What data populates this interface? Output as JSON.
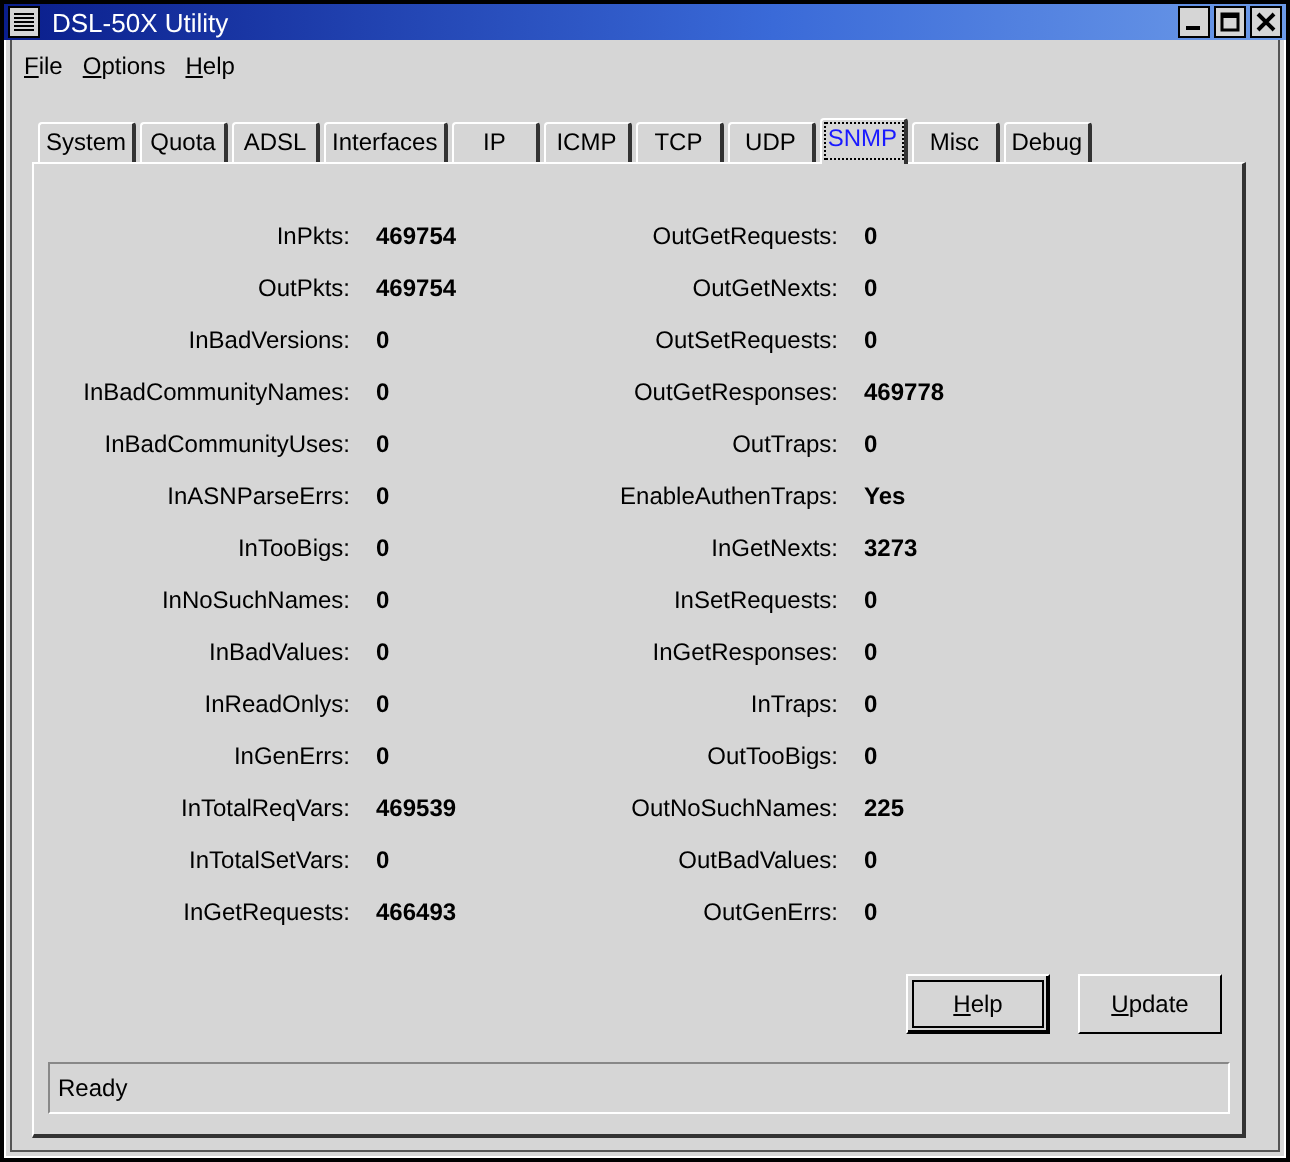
{
  "window": {
    "title": "DSL-50X Utility"
  },
  "menu": [
    {
      "label": "File",
      "mnemonic": true
    },
    {
      "label": "Options",
      "mnemonic": true
    },
    {
      "label": "Help",
      "mnemonic": true
    }
  ],
  "tabs": [
    {
      "label": "System",
      "selected": false
    },
    {
      "label": "Quota",
      "selected": false
    },
    {
      "label": "ADSL",
      "selected": false
    },
    {
      "label": "Interfaces",
      "selected": false
    },
    {
      "label": "IP",
      "selected": false
    },
    {
      "label": "ICMP",
      "selected": false
    },
    {
      "label": "TCP",
      "selected": false
    },
    {
      "label": "UDP",
      "selected": false
    },
    {
      "label": "SNMP",
      "selected": true
    },
    {
      "label": "Misc",
      "selected": false
    },
    {
      "label": "Debug",
      "selected": false
    }
  ],
  "stats_left": [
    {
      "label": "InPkts:",
      "value": "469754"
    },
    {
      "label": "OutPkts:",
      "value": "469754"
    },
    {
      "label": "InBadVersions:",
      "value": "0"
    },
    {
      "label": "InBadCommunityNames:",
      "value": "0"
    },
    {
      "label": "InBadCommunityUses:",
      "value": "0"
    },
    {
      "label": "InASNParseErrs:",
      "value": "0"
    },
    {
      "label": "InTooBigs:",
      "value": "0"
    },
    {
      "label": "InNoSuchNames:",
      "value": "0"
    },
    {
      "label": "InBadValues:",
      "value": "0"
    },
    {
      "label": "InReadOnlys:",
      "value": "0"
    },
    {
      "label": "InGenErrs:",
      "value": "0"
    },
    {
      "label": "InTotalReqVars:",
      "value": "469539"
    },
    {
      "label": "InTotalSetVars:",
      "value": "0"
    },
    {
      "label": "InGetRequests:",
      "value": "466493"
    }
  ],
  "stats_right": [
    {
      "label": "OutGetRequests:",
      "value": "0"
    },
    {
      "label": "OutGetNexts:",
      "value": "0"
    },
    {
      "label": "OutSetRequests:",
      "value": "0"
    },
    {
      "label": "OutGetResponses:",
      "value": "469778"
    },
    {
      "label": "OutTraps:",
      "value": "0"
    },
    {
      "label": "EnableAuthenTraps:",
      "value": "Yes"
    },
    {
      "label": "InGetNexts:",
      "value": "3273"
    },
    {
      "label": "InSetRequests:",
      "value": "0"
    },
    {
      "label": "InGetResponses:",
      "value": "0"
    },
    {
      "label": "InTraps:",
      "value": "0"
    },
    {
      "label": "OutTooBigs:",
      "value": "0"
    },
    {
      "label": "OutNoSuchNames:",
      "value": "225"
    },
    {
      "label": "OutBadValues:",
      "value": "0"
    },
    {
      "label": "OutGenErrs:",
      "value": "0"
    }
  ],
  "buttons": [
    {
      "label": "Help",
      "mnemonic": true,
      "default": true
    },
    {
      "label": "Update",
      "mnemonic": true,
      "default": false
    }
  ],
  "status_bar": "Ready"
}
